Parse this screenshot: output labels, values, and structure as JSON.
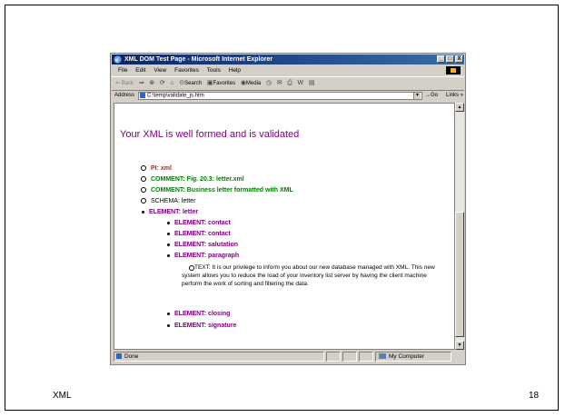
{
  "slide": {
    "footer_left": "XML",
    "footer_right": "18"
  },
  "window": {
    "title": "XML DOM Test Page - Microsoft Internet Explorer",
    "minimize": "_",
    "maximize": "□",
    "close": "X"
  },
  "menu": [
    "File",
    "Edit",
    "View",
    "Favorites",
    "Tools",
    "Help"
  ],
  "toolbar": {
    "back": "⇐ Back",
    "forward": "⇒",
    "search": "Search",
    "favorites": "Favorites",
    "media": "Media"
  },
  "address": {
    "label": "Address",
    "value": "C:\\temp\\validate_js.htm",
    "go": "Go",
    "links": "Links »"
  },
  "content": {
    "heading": "Your XML is well formed and is validated",
    "items": [
      {
        "text": "PI: xml"
      },
      {
        "text": "COMMENT: Fig. 20.3: letter.xml"
      },
      {
        "text": "COMMENT: Business letter formatted with XML"
      },
      {
        "text": "SCHEMA: letter"
      },
      {
        "text": "ELEMENT: letter"
      },
      {
        "text": "ELEMENT: contact"
      },
      {
        "text": "ELEMENT: contact"
      },
      {
        "text": "ELEMENT: salutation"
      },
      {
        "text": "ELEMENT: paragraph"
      },
      {
        "text": "TEXT: It is our privilege to inform you about our new database managed with XML. This new system allows you to reduce the load of your inventory list server by having the client machine perform the work of sorting and filtering the data."
      },
      {
        "text": "ELEMENT: closing"
      },
      {
        "text": "ELEMENT: signature"
      }
    ]
  },
  "status": {
    "done": "Done",
    "zone": "My Computer"
  },
  "colors": {
    "heading": "#800080",
    "pi": "#b22222",
    "comment": "#008000",
    "element": "#800080"
  }
}
